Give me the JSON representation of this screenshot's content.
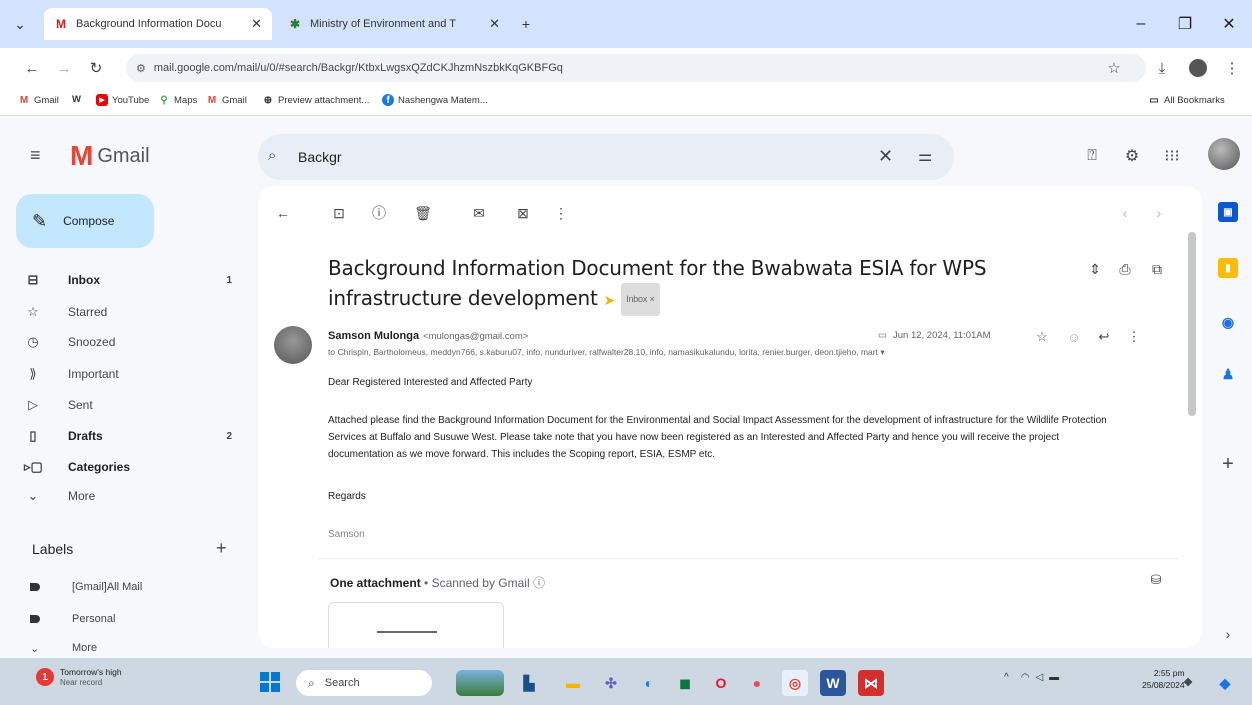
{
  "browser": {
    "tabs": [
      {
        "title": "Background Information Docu",
        "favicon": "M"
      },
      {
        "title": "Ministry of Environment and T",
        "favicon": "✱"
      }
    ],
    "url": "mail.google.com/mail/u/0/#search/Backgr/KtbxLwgsxQZdCKJhzmNszbkKqGKBFGq",
    "bookmarks": [
      "Gmail",
      "W",
      "YouTube",
      "Maps",
      "Gmail",
      "Preview attachment...",
      "Nashengwa Matem..."
    ],
    "all_bookmarks": "All Bookmarks"
  },
  "gmail": {
    "logo_text": "Gmail",
    "search_value": "Backgr",
    "compose_label": "Compose",
    "nav": [
      {
        "label": "Inbox",
        "count": "1",
        "icon": "inbox-icon",
        "bold": true
      },
      {
        "label": "Starred",
        "count": "",
        "icon": "star-icon",
        "bold": false
      },
      {
        "label": "Snoozed",
        "count": "",
        "icon": "clock-icon",
        "bold": false
      },
      {
        "label": "Important",
        "count": "",
        "icon": "important-icon",
        "bold": false
      },
      {
        "label": "Sent",
        "count": "",
        "icon": "send-icon",
        "bold": false
      },
      {
        "label": "Drafts",
        "count": "2",
        "icon": "draft-icon",
        "bold": true
      },
      {
        "label": "Categories",
        "count": "",
        "icon": "label-icon",
        "bold": true
      },
      {
        "label": "More",
        "count": "",
        "icon": "chevron-down-icon",
        "bold": false
      }
    ],
    "labels_title": "Labels",
    "labels": [
      "[Gmail]All Mail",
      "Personal",
      "More"
    ],
    "email": {
      "subject": "Background Information Document for the Bwabwata ESIA for WPS infrastructure development",
      "inbox_chip": "Inbox ×",
      "sender_name": "Samson Mulonga",
      "sender_email": "<mulongas@gmail.com>",
      "date": "Jun 12, 2024, 11:01AM",
      "recipients": "to Chrispin, Bartholomeus, meddyn766, s.kaburu07, info, nunduriver, ralfwalter28.10, info, namasikukalundu, lorita, renier.burger, deon.tjieho, mart ▾",
      "greeting": "Dear Registered Interested and Affected Party",
      "body": "Attached please find the Background Information Document for the Environmental and Social Impact Assessment for the development of infrastructure for the Wildlife Protection Services at Buffalo and Susuwe West. Please take note that you have now been registered as an Interested and Affected Party and hence you will receive the project documentation as we move forward. This includes the Scoping report, ESIA, ESMP etc.",
      "regards": "Regards",
      "signature": "Samson",
      "attachment_title": "One attachment",
      "attachment_scan": "• Scanned by Gmail ⓘ"
    }
  },
  "taskbar": {
    "weather_title": "Tomorrow's high",
    "weather_sub": "Near record",
    "search_placeholder": "Search",
    "time": "2:55 pm",
    "date": "25/08/2024"
  },
  "colors": {
    "accent": "#0b57d0",
    "compose_bg": "#c2e7ff",
    "tab_strip": "#d3e3fd",
    "gmail_red": "#ea4335"
  }
}
